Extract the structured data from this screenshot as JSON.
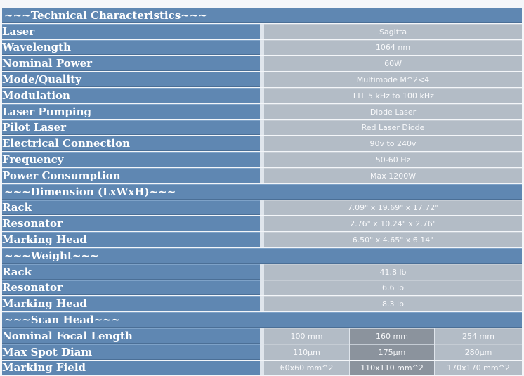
{
  "sections": {
    "technical": "~~~Technical Characteristics~~~",
    "dimension": "~~~Dimension (LxWxH)~~~",
    "weight": "~~~Weight~~~",
    "scan": "~~~Scan Head~~~"
  },
  "technical": [
    {
      "label": "Laser",
      "value": "Sagitta"
    },
    {
      "label": "Wavelength",
      "value": "1064 nm"
    },
    {
      "label": "Nominal Power",
      "value": "60W"
    },
    {
      "label": "Mode/Quality",
      "value": "Multimode M^2<4"
    },
    {
      "label": "Modulation",
      "value": "TTL 5 kHz to 100 kHz"
    },
    {
      "label": "Laser Pumping",
      "value": "Diode Laser"
    },
    {
      "label": "Pilot Laser",
      "value": "Red Laser Diode"
    },
    {
      "label": "Electrical Connection",
      "value": "90v to 240v"
    },
    {
      "label": "Frequency",
      "value": "50-60 Hz"
    },
    {
      "label": "Power Consumption",
      "value": "Max 1200W"
    }
  ],
  "dimension": [
    {
      "label": "Rack",
      "value": "7.09\" x 19.69\" x 17.72\""
    },
    {
      "label": "Resonator",
      "value": "2.76\" x 10.24\" x 2.76\""
    },
    {
      "label": "Marking Head",
      "value": "6.50\" x 4.65\" x 6.14\""
    }
  ],
  "weight": [
    {
      "label": "Rack",
      "value": "41.8 lb"
    },
    {
      "label": "Resonator",
      "value": "6.6 lb"
    },
    {
      "label": "Marking Head",
      "value": "8.3 lb"
    }
  ],
  "scan": [
    {
      "label": "Nominal Focal Length",
      "values": [
        "100 mm",
        "160 mm",
        "254 mm"
      ]
    },
    {
      "label": "Max Spot Diam",
      "values": [
        "110µm",
        "175µm",
        "280µm"
      ]
    },
    {
      "label": "Marking Field",
      "values": [
        "60x60 mm^2",
        "110x110 mm^2",
        "170x170 mm^2"
      ]
    }
  ],
  "colors": {
    "label_bg": "#5f87b2",
    "value_bg": "#b3bcc6",
    "value_highlight_bg": "#8b939d",
    "text_light": "#ffffff"
  }
}
